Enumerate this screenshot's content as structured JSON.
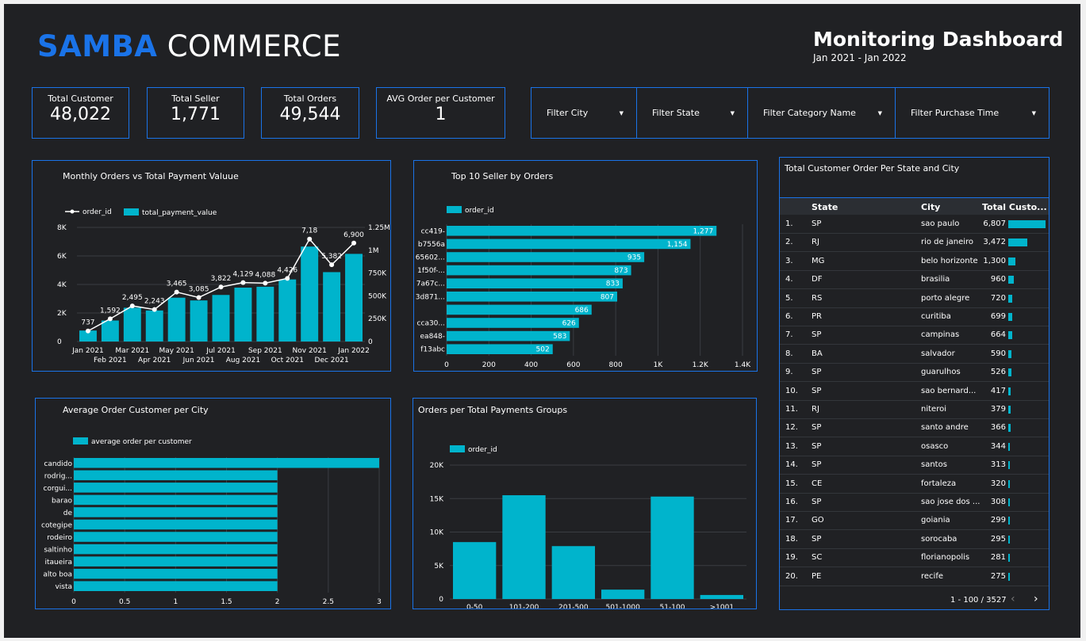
{
  "header": {
    "brand_part1": "SAMBA",
    "brand_part2": "COMMERCE",
    "title": "Monitoring Dashboard",
    "date_range": "Jan 2021 - Jan 2022"
  },
  "kpis": [
    {
      "label": "Total Customer",
      "value": "48,022"
    },
    {
      "label": "Total Seller",
      "value": "1,771"
    },
    {
      "label": "Total Orders",
      "value": "49,544"
    },
    {
      "label": "AVG Order per Customer",
      "value": "1"
    }
  ],
  "filters": [
    {
      "label": "Filter City"
    },
    {
      "label": "Filter State"
    },
    {
      "label": "Filter Category Name"
    },
    {
      "label": "Filter Purchase Time"
    }
  ],
  "colors": {
    "background": "#202124",
    "accent": "#1a73e8",
    "bar": "#00b4cc",
    "line": "#ffffff"
  },
  "chart_data": [
    {
      "type": "bar",
      "title": "Monthly Orders vs Total Payment Valuue",
      "legend": [
        "order_id",
        "total_payment_value"
      ],
      "categories": [
        "Jan 2021",
        "Feb 2021",
        "Mar 2021",
        "Apr 2021",
        "May 2021",
        "Jun 2021",
        "Jul 2021",
        "Aug 2021",
        "Sep 2021",
        "Oct 2021",
        "Nov 2021",
        "Dec 2021",
        "Jan 2022"
      ],
      "series": [
        {
          "name": "order_id",
          "type": "line",
          "values": [
            737,
            1592,
            2495,
            2243,
            3465,
            3085,
            3822,
            4129,
            4088,
            4426,
            7181,
            5382,
            6900
          ],
          "labels": [
            "737",
            "1,592",
            "2,495",
            "2,243",
            "3,465",
            "3,085",
            "3,822",
            "4,129",
            "4,088",
            "4,426",
            "7,18",
            "5,382",
            "6,900"
          ]
        },
        {
          "name": "total_payment_value",
          "type": "bar",
          "values": [
            120000,
            230000,
            370000,
            340000,
            480000,
            450000,
            510000,
            590000,
            600000,
            680000,
            1040000,
            760000,
            960000
          ]
        }
      ],
      "y_left_ticks": [
        "0",
        "2K",
        "4K",
        "6K",
        "8K"
      ],
      "y_left_max": 8000,
      "y_right_ticks": [
        "0",
        "250K",
        "500K",
        "750K",
        "1M",
        "1.25M"
      ],
      "y_right_max": 1250000
    },
    {
      "type": "bar",
      "orientation": "horizontal",
      "title": "Top 10 Seller by Orders",
      "legend": [
        "order_id"
      ],
      "categories": [
        "cc419-",
        "b7556a",
        "65602...",
        "1f50f-...",
        "7a67c...",
        "3d871...",
        "",
        "cca30...",
        "ea848-",
        "f13abc"
      ],
      "values": [
        1277,
        1154,
        935,
        873,
        833,
        807,
        686,
        626,
        583,
        502
      ],
      "value_labels": [
        "1,277",
        "1,154",
        "935",
        "873",
        "833",
        "807",
        "686",
        "626",
        "583",
        "502"
      ],
      "x_ticks": [
        "0",
        "200",
        "400",
        "600",
        "800",
        "1K",
        "1.2K",
        "1.4K"
      ],
      "xlim": [
        0,
        1400
      ]
    },
    {
      "type": "bar",
      "orientation": "horizontal",
      "title": "Average Order Customer per City",
      "legend": [
        "average order per customer"
      ],
      "categories": [
        "candido",
        "rodrig...",
        "corgui...",
        "barao",
        "de",
        "cotegipe",
        "rodeiro",
        "saltinho",
        "itaueira",
        "alto boa",
        "vista"
      ],
      "values": [
        3,
        2,
        2,
        2,
        2,
        2,
        2,
        2,
        2,
        2,
        2
      ],
      "x_ticks": [
        "0",
        "0.5",
        "1",
        "1.5",
        "2",
        "2.5",
        "3"
      ],
      "xlim": [
        0,
        3
      ]
    },
    {
      "type": "bar",
      "title": "Orders per Total Payments Groups",
      "legend": [
        "order_id"
      ],
      "categories": [
        "0-50",
        "101-200",
        "201-500",
        "501-1000",
        "51-100",
        ">1001"
      ],
      "values": [
        8500,
        15500,
        7900,
        1400,
        15300,
        600
      ],
      "y_ticks": [
        "0",
        "5K",
        "10K",
        "15K",
        "20K"
      ],
      "ylim": [
        0,
        20000
      ]
    }
  ],
  "table": {
    "title": "Total Customer Order Per State and City",
    "columns": [
      "State",
      "City",
      "Total Custo..."
    ],
    "max_value": 6807,
    "rows": [
      {
        "rank": "1.",
        "state": "SP",
        "city": "sao paulo",
        "total": "6,807",
        "value": 6807
      },
      {
        "rank": "2.",
        "state": "RJ",
        "city": "rio de janeiro",
        "total": "3,472",
        "value": 3472
      },
      {
        "rank": "3.",
        "state": "MG",
        "city": "belo horizonte",
        "total": "1,300",
        "value": 1300
      },
      {
        "rank": "4.",
        "state": "DF",
        "city": "brasilia",
        "total": "960",
        "value": 960
      },
      {
        "rank": "5.",
        "state": "RS",
        "city": "porto alegre",
        "total": "720",
        "value": 720
      },
      {
        "rank": "6.",
        "state": "PR",
        "city": "curitiba",
        "total": "699",
        "value": 699
      },
      {
        "rank": "7.",
        "state": "SP",
        "city": "campinas",
        "total": "664",
        "value": 664
      },
      {
        "rank": "8.",
        "state": "BA",
        "city": "salvador",
        "total": "590",
        "value": 590
      },
      {
        "rank": "9.",
        "state": "SP",
        "city": "guarulhos",
        "total": "526",
        "value": 526
      },
      {
        "rank": "10.",
        "state": "SP",
        "city": "sao bernard...",
        "total": "417",
        "value": 417
      },
      {
        "rank": "11.",
        "state": "RJ",
        "city": "niteroi",
        "total": "379",
        "value": 379
      },
      {
        "rank": "12.",
        "state": "SP",
        "city": "santo andre",
        "total": "366",
        "value": 366
      },
      {
        "rank": "13.",
        "state": "SP",
        "city": "osasco",
        "total": "344",
        "value": 344
      },
      {
        "rank": "14.",
        "state": "SP",
        "city": "santos",
        "total": "313",
        "value": 313
      },
      {
        "rank": "15.",
        "state": "CE",
        "city": "fortaleza",
        "total": "320",
        "value": 320
      },
      {
        "rank": "16.",
        "state": "SP",
        "city": "sao jose dos ...",
        "total": "308",
        "value": 308
      },
      {
        "rank": "17.",
        "state": "GO",
        "city": "goiania",
        "total": "299",
        "value": 299
      },
      {
        "rank": "18.",
        "state": "SP",
        "city": "sorocaba",
        "total": "295",
        "value": 295
      },
      {
        "rank": "19.",
        "state": "SC",
        "city": "florianopolis",
        "total": "281",
        "value": 281
      },
      {
        "rank": "20.",
        "state": "PE",
        "city": "recife",
        "total": "275",
        "value": 275
      }
    ],
    "pagination": "1 - 100 / 3527",
    "prev_icon": "chevron-left-icon",
    "next_icon": "chevron-right-icon"
  }
}
